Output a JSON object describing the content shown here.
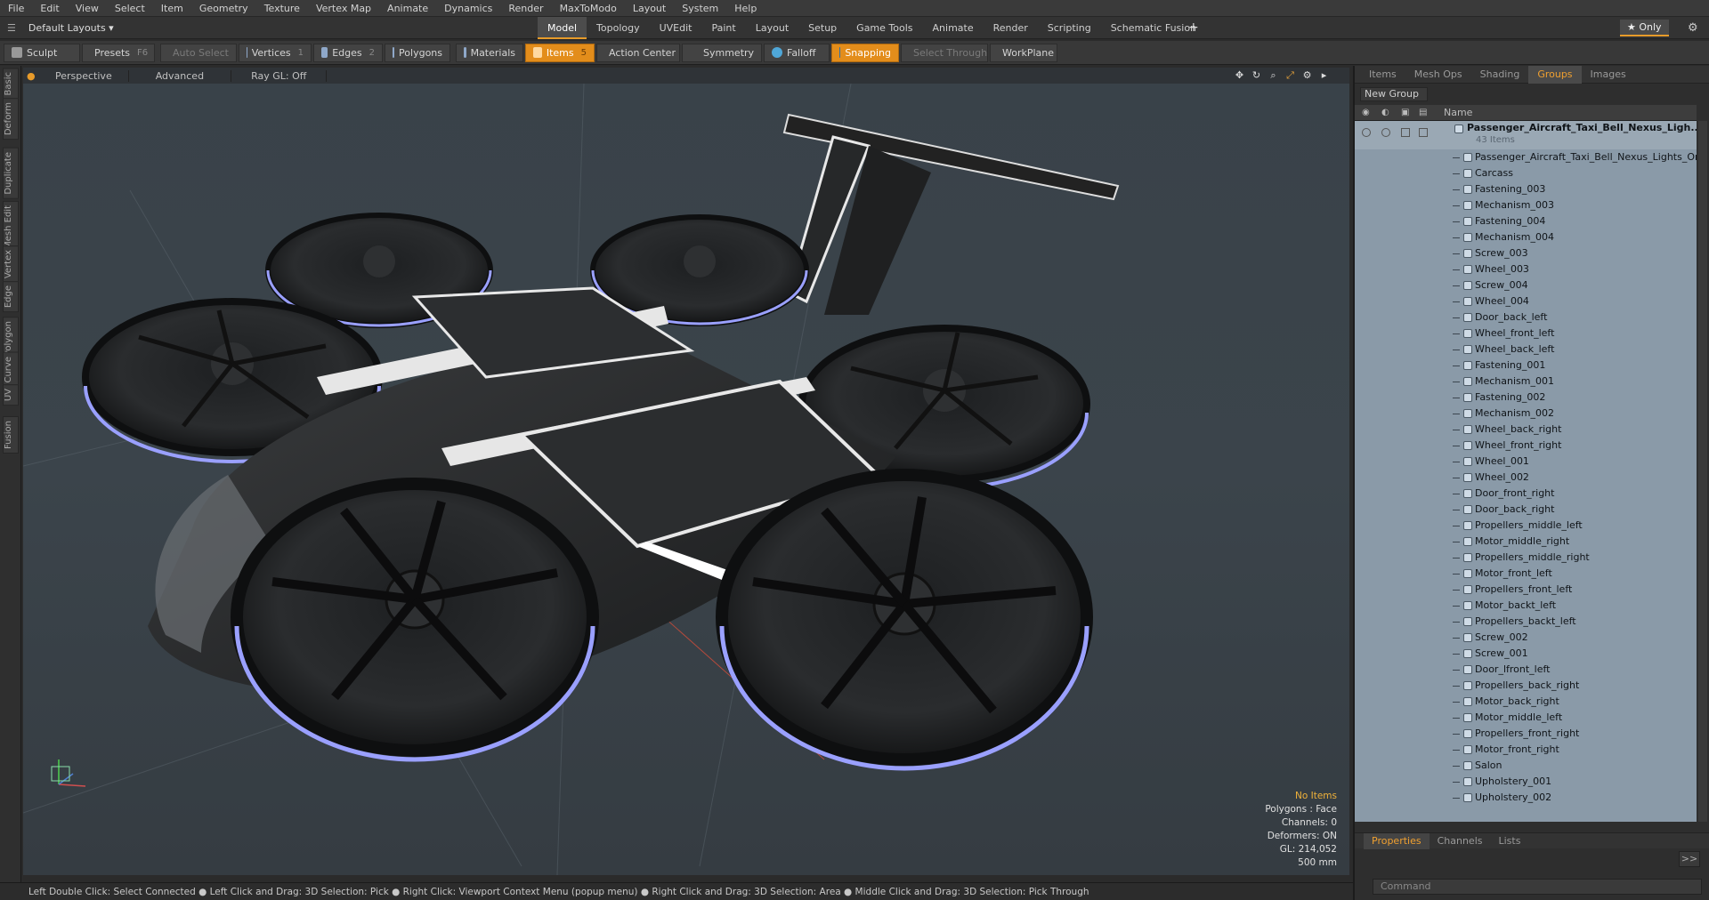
{
  "menu": [
    "File",
    "Edit",
    "View",
    "Select",
    "Item",
    "Geometry",
    "Texture",
    "Vertex Map",
    "Animate",
    "Dynamics",
    "Render",
    "MaxToModo",
    "Layout",
    "System",
    "Help"
  ],
  "layout_selector": "Default Layouts ▾",
  "tabs": [
    "Model",
    "Topology",
    "UVEdit",
    "Paint",
    "Layout",
    "Setup",
    "Game Tools",
    "Animate",
    "Render",
    "Scripting",
    "Schematic Fusion"
  ],
  "add_tab": "+",
  "only_label": "★  Only",
  "toolbar": {
    "sculpt": "Sculpt",
    "presets": "Presets",
    "presets_key": "F6",
    "auto_select": "Auto Select",
    "vertices": "Vertices",
    "vertices_num": "1",
    "edges": "Edges",
    "edges_num": "2",
    "polygons": "Polygons",
    "materials": "Materials",
    "items": "Items",
    "items_num": "5",
    "action_center": "Action Center",
    "symmetry": "Symmetry",
    "falloff": "Falloff",
    "snapping": "Snapping",
    "select_through": "Select Through",
    "workplane": "WorkPlane"
  },
  "left_tabs": [
    "Basic",
    "Deform",
    "Duplicate",
    "Mesh Edit",
    "Vertex",
    "Edge",
    "Polygon",
    "Curve",
    "UV",
    "Fusion"
  ],
  "viewport": {
    "perspective": "Perspective",
    "advanced": "Advanced",
    "raygl": "Ray GL: Off"
  },
  "info": {
    "no_items": "No Items",
    "polygons": "Polygons : Face",
    "channels": "Channels: 0",
    "deformers": "Deformers: ON",
    "gl": "GL: 214,052",
    "scale": "500 mm"
  },
  "status": "Left Double Click: Select Connected ● Left Click and Drag: 3D Selection: Pick ● Right Click: Viewport Context Menu (popup menu) ● Right Click and Drag: 3D Selection: Area ● Middle Click and Drag: 3D Selection: Pick Through",
  "right_tabs": [
    "Items",
    "Mesh Ops",
    "Shading",
    "Groups",
    "Images"
  ],
  "right_active": "Groups",
  "new_group": "New Group",
  "list_header": "Name",
  "root": {
    "name": "Passenger_Aircraft_Taxi_Bell_Nexus_Ligh...",
    "count": "43 Items"
  },
  "items": [
    "Passenger_Aircraft_Taxi_Bell_Nexus_Lights_On",
    "Carcass",
    "Fastening_003",
    "Mechanism_003",
    "Fastening_004",
    "Mechanism_004",
    "Screw_003",
    "Wheel_003",
    "Screw_004",
    "Wheel_004",
    "Door_back_left",
    "Wheel_front_left",
    "Wheel_back_left",
    "Fastening_001",
    "Mechanism_001",
    "Fastening_002",
    "Mechanism_002",
    "Wheel_back_right",
    "Wheel_front_right",
    "Wheel_001",
    "Wheel_002",
    "Door_front_right",
    "Door_back_right",
    "Propellers_middle_left",
    "Motor_middle_right",
    "Propellers_middle_right",
    "Motor_front_left",
    "Propellers_front_left",
    "Motor_backt_left",
    "Propellers_backt_left",
    "Screw_002",
    "Screw_001",
    "Door_lfront_left",
    "Propellers_back_right",
    "Motor_back_right",
    "Motor_middle_left",
    "Propellers_front_right",
    "Motor_front_right",
    "Salon",
    "Upholstery_001",
    "Upholstery_002"
  ],
  "bottom_tabs": [
    "Properties",
    "Channels",
    "Lists"
  ],
  "bottom_active": "Properties",
  "command_placeholder": "Command",
  "accent": "#e38d1b"
}
